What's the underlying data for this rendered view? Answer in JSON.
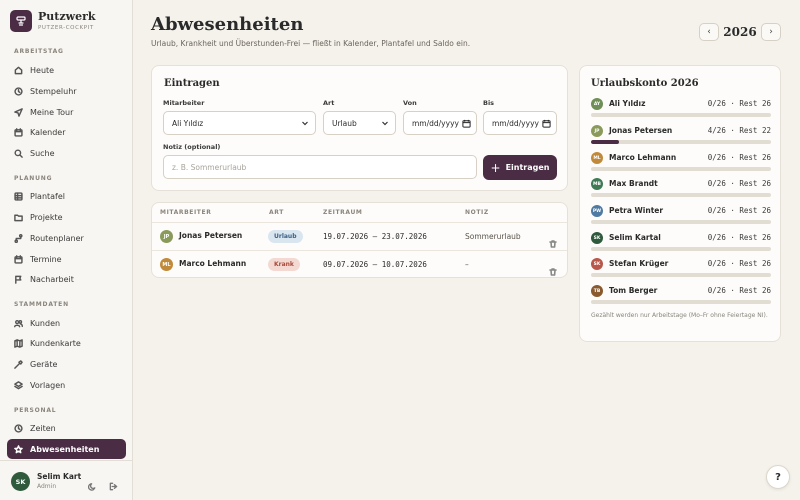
{
  "brand": {
    "name": "Putzwerk",
    "subtitle": "PUTZER-COCKPIT"
  },
  "nav": {
    "sections": [
      {
        "label": "ARBEITSTAG",
        "items": [
          {
            "label": "Heute",
            "icon": "home-icon"
          },
          {
            "label": "Stempeluhr",
            "icon": "clock-icon"
          },
          {
            "label": "Meine Tour",
            "icon": "send-icon"
          },
          {
            "label": "Kalender",
            "icon": "calendar-icon"
          },
          {
            "label": "Suche",
            "icon": "search-icon"
          }
        ]
      },
      {
        "label": "PLANUNG",
        "items": [
          {
            "label": "Plantafel",
            "icon": "grid-icon"
          },
          {
            "label": "Projekte",
            "icon": "folder-icon"
          },
          {
            "label": "Routenplaner",
            "icon": "route-icon"
          },
          {
            "label": "Termine",
            "icon": "calendar-icon"
          },
          {
            "label": "Nacharbeit",
            "icon": "flag-icon"
          }
        ]
      },
      {
        "label": "STAMMDATEN",
        "items": [
          {
            "label": "Kunden",
            "icon": "users-icon"
          },
          {
            "label": "Kundenkarte",
            "icon": "map-icon"
          },
          {
            "label": "Geräte",
            "icon": "tool-icon"
          },
          {
            "label": "Vorlagen",
            "icon": "layers-icon"
          }
        ]
      },
      {
        "label": "PERSONAL",
        "items": [
          {
            "label": "Zeiten",
            "icon": "clock-icon"
          },
          {
            "label": "Abwesenheiten",
            "icon": "star-icon",
            "active": true
          }
        ]
      }
    ]
  },
  "user": {
    "initials": "SK",
    "name": "Selim Kartal",
    "role": "Admin"
  },
  "header": {
    "title": "Abwesenheiten",
    "subtitle": "Urlaub, Krankheit und Überstunden-Frei — fließt in Kalender, Plantafel und Saldo ein.",
    "year": "2026",
    "prev": "‹",
    "next": "›"
  },
  "form": {
    "title": "Eintragen",
    "employee_label": "Mitarbeiter",
    "employee_value": "Ali Yıldız",
    "type_label": "Art",
    "type_value": "Urlaub",
    "from_label": "Von",
    "from_value": "mm/dd/yyyy",
    "to_label": "Bis",
    "to_value": "mm/dd/yyyy",
    "note_label": "Notiz (optional)",
    "note_placeholder": "z. B. Sommerurlaub",
    "submit_label": "Eintragen"
  },
  "table": {
    "headers": [
      "MITARBEITER",
      "ART",
      "ZEITRAUM",
      "NOTIZ"
    ],
    "rows": [
      {
        "initials": "JP",
        "avatar_color": "#8a9a5b",
        "name": "Jonas Petersen",
        "type": "Urlaub",
        "type_style": "urlaub",
        "period": "19.07.2026 – 23.07.2026",
        "note": "Sommerurlaub"
      },
      {
        "initials": "ML",
        "avatar_color": "#c08a3a",
        "name": "Marco Lehmann",
        "type": "Krank",
        "type_style": "krank",
        "period": "09.07.2026 – 10.07.2026",
        "note": "–"
      }
    ]
  },
  "vacation_account": {
    "title": "Urlaubskonto 2026",
    "entries": [
      {
        "initials": "AY",
        "color": "#6e8f55",
        "name": "Ali Yıldız",
        "stat": "0/26 · Rest 26",
        "used": 0,
        "total": 26
      },
      {
        "initials": "JP",
        "color": "#8a9a5b",
        "name": "Jonas Petersen",
        "stat": "4/26 · Rest 22",
        "used": 4,
        "total": 26
      },
      {
        "initials": "ML",
        "color": "#c08a3a",
        "name": "Marco Lehmann",
        "stat": "0/26 · Rest 26",
        "used": 0,
        "total": 26
      },
      {
        "initials": "MB",
        "color": "#3f7a55",
        "name": "Max Brandt",
        "stat": "0/26 · Rest 26",
        "used": 0,
        "total": 26
      },
      {
        "initials": "PW",
        "color": "#4f7aa3",
        "name": "Petra Winter",
        "stat": "0/26 · Rest 26",
        "used": 0,
        "total": 26
      },
      {
        "initials": "SK",
        "color": "#2f5a3c",
        "name": "Selim Kartal",
        "stat": "0/26 · Rest 26",
        "used": 0,
        "total": 26
      },
      {
        "initials": "SK",
        "color": "#b8574a",
        "name": "Stefan Krüger",
        "stat": "0/26 · Rest 26",
        "used": 0,
        "total": 26
      },
      {
        "initials": "TB",
        "color": "#8a5a2e",
        "name": "Tom Berger",
        "stat": "0/26 · Rest 26",
        "used": 0,
        "total": 26
      }
    ],
    "note": "Gezählt werden nur Arbeitstage (Mo–Fr ohne Feiertage NI)."
  },
  "help_label": "?",
  "colors": {
    "accent": "#4a2c44",
    "urlaub_badge_bg": "#d9e6f0",
    "urlaub_badge_fg": "#3a5f80",
    "krank_badge_bg": "#f3d9d2",
    "krank_badge_fg": "#a84a3a"
  }
}
